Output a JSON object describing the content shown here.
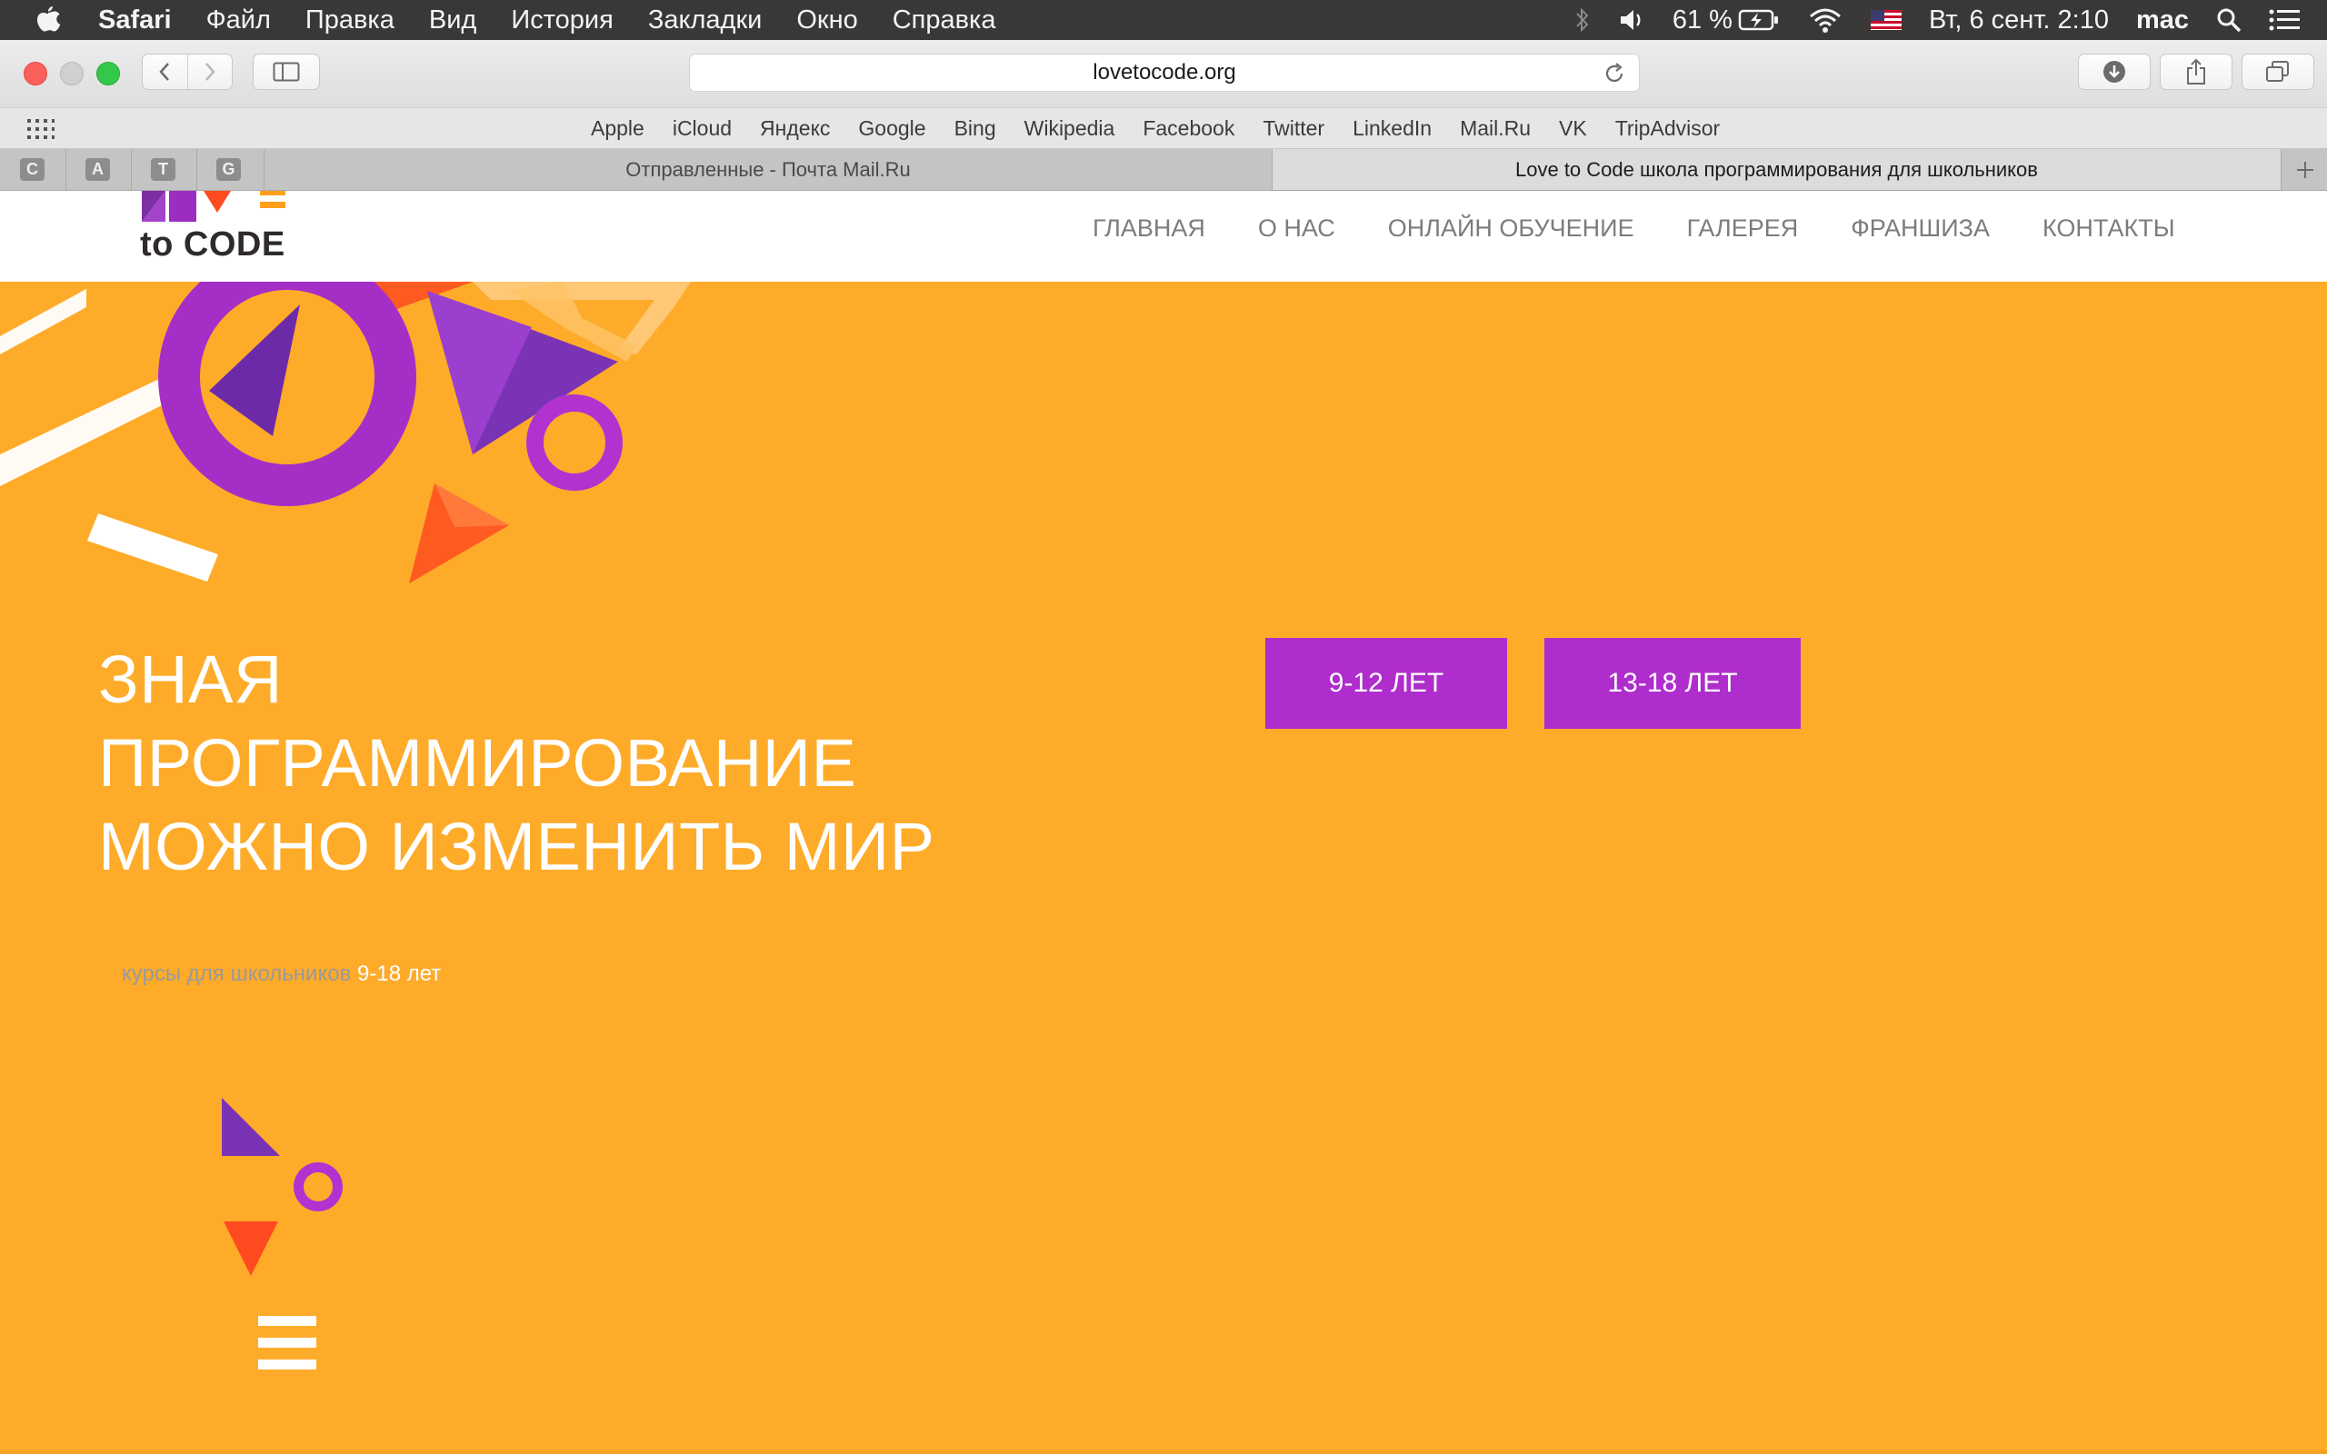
{
  "menubar": {
    "app_name": "Safari",
    "menus": [
      "Файл",
      "Правка",
      "Вид",
      "История",
      "Закладки",
      "Окно",
      "Справка"
    ],
    "battery": "61 %",
    "datetime": "Вт, 6 сент.  2:10",
    "user": "mac"
  },
  "toolbar": {
    "url": "lovetocode.org"
  },
  "favorites": [
    "Apple",
    "iCloud",
    "Яндекс",
    "Google",
    "Bing",
    "Wikipedia",
    "Facebook",
    "Twitter",
    "LinkedIn",
    "Mail.Ru",
    "VK",
    "TripAdvisor"
  ],
  "tabs": {
    "pinned": [
      "C",
      "A",
      "T",
      "G"
    ],
    "items": [
      {
        "label": "Отправленные - Почта Mail.Ru"
      },
      {
        "label": "Love to Code школа программирования для школьников"
      }
    ]
  },
  "site": {
    "logo_text": "to CODE",
    "nav": [
      "ГЛАВНАЯ",
      "О НАС",
      "ОНЛАЙН ОБУЧЕНИЕ",
      "ГАЛЕРЕЯ",
      "ФРАНШИЗА",
      "КОНТАКТЫ"
    ],
    "headline": [
      "ЗНАЯ",
      "ПРОГРАММИРОВАНИЕ",
      "МОЖНО ИЗМЕНИТЬ МИР"
    ],
    "subline_muted": "курсы для школьников",
    "subline_strong": "9-18 лет",
    "buttons": [
      "9-12 ЛЕТ",
      "13-18 ЛЕТ"
    ]
  },
  "colors": {
    "hero_bg": "#feab2a",
    "accent_purple": "#ae2dcc",
    "accent_orange_red": "#ff5a1f"
  }
}
